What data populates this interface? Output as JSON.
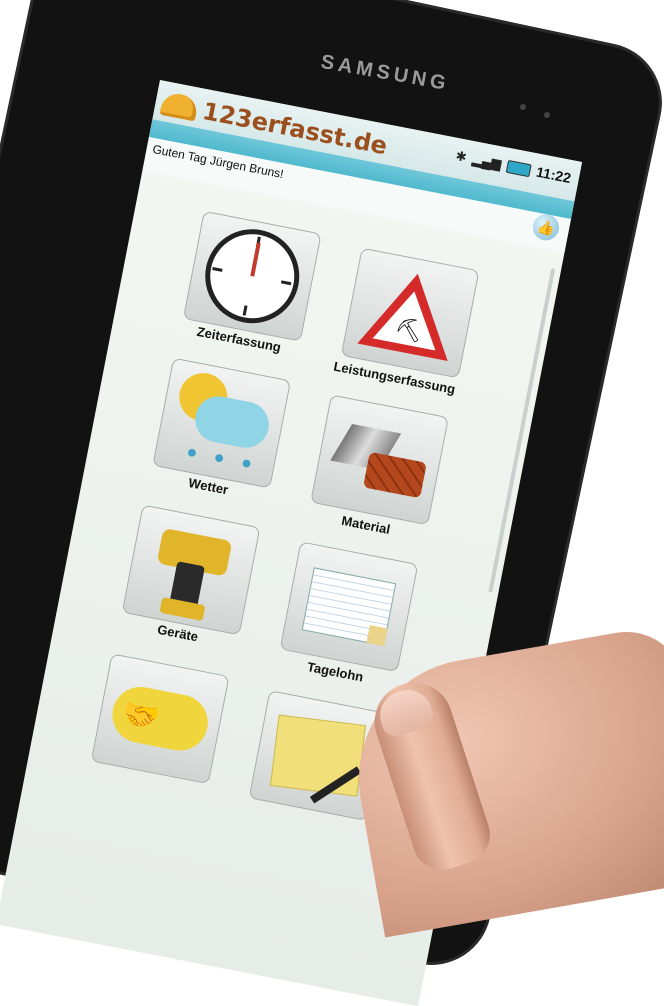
{
  "device": {
    "brand": "SAMSUNG"
  },
  "status_bar": {
    "time": "11:22"
  },
  "app": {
    "logo_text": "123erfasst.de",
    "greeting": "Guten Tag Jürgen Bruns!"
  },
  "tiles": [
    {
      "label": "Zeiterfassung",
      "icon": "clock-icon"
    },
    {
      "label": "Leistungserfassung",
      "icon": "construction-warning-icon"
    },
    {
      "label": "Wetter",
      "icon": "weather-icon"
    },
    {
      "label": "Material",
      "icon": "material-icon"
    },
    {
      "label": "Geräte",
      "icon": "drill-icon"
    },
    {
      "label": "Tagelohn",
      "icon": "timesheet-icon"
    },
    {
      "label": "",
      "icon": "handshake-icon"
    },
    {
      "label": "",
      "icon": "note-icon"
    }
  ],
  "colors": {
    "accent": "#3fb1c8",
    "logo": "#9a4f1c",
    "warning": "#d42a2a"
  }
}
